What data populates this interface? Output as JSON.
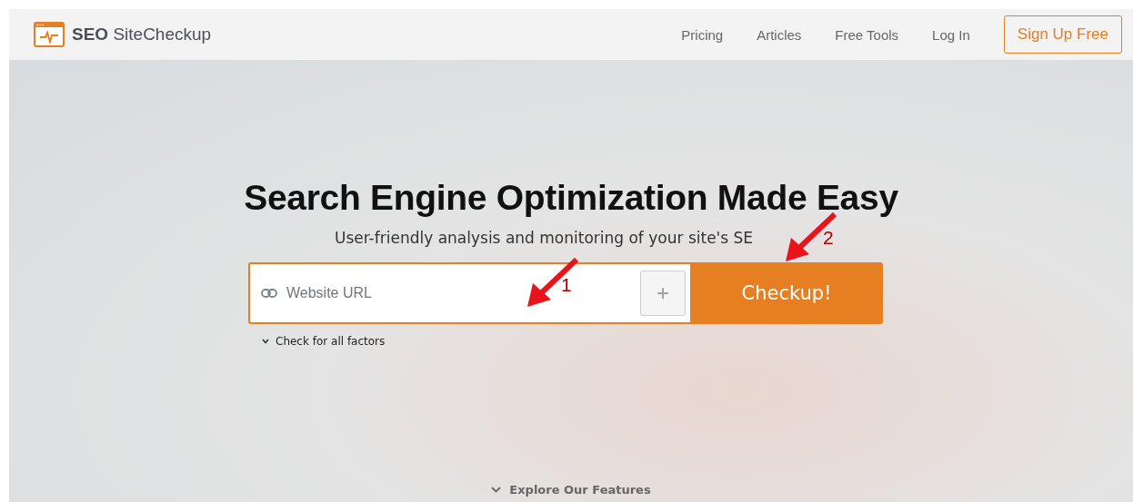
{
  "header": {
    "logo": {
      "bold": "SEO",
      "rest": "SiteCheckup"
    },
    "nav": [
      "Pricing",
      "Articles",
      "Free Tools",
      "Log In"
    ],
    "signup": "Sign Up Free"
  },
  "hero": {
    "title": "Search Engine Optimization Made Easy",
    "subtitle": "User-friendly analysis and monitoring of your site's SE",
    "url_field": {
      "placeholder": "Website URL"
    },
    "add_button": "+",
    "submit": "Checkup!",
    "options_toggle": "Check for all factors",
    "explore": "Explore Our Features"
  },
  "annotations": [
    {
      "label": "1"
    },
    {
      "label": "2"
    }
  ]
}
